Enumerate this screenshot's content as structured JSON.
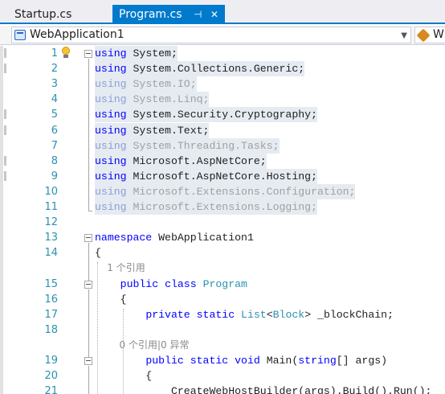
{
  "tabs": [
    {
      "label": "Startup.cs",
      "active": false
    },
    {
      "label": "Program.cs",
      "active": true,
      "pin_glyph": "⊣",
      "close_glyph": "✕"
    }
  ],
  "navbar": {
    "project": "WebApplication1",
    "member_partial": "W",
    "project_icon": "csharp-project-icon",
    "member_icon": "member-icon"
  },
  "editor": {
    "colors": {
      "keyword": "#0000ff",
      "type": "#2b91af",
      "line_number": "#2b91af",
      "selection": "#e5ebf1",
      "accent": "#007acc"
    },
    "lines": [
      {
        "n": "1",
        "tokens": [
          {
            "t": "using",
            "c": "kw"
          },
          {
            "t": " System;",
            "c": ""
          }
        ],
        "highlight": true,
        "faded": false,
        "fold": true,
        "bulb": true
      },
      {
        "n": "2",
        "tokens": [
          {
            "t": "using",
            "c": "kw"
          },
          {
            "t": " System.Collections.Generic;",
            "c": ""
          }
        ],
        "highlight": true,
        "faded": false
      },
      {
        "n": "3",
        "tokens": [
          {
            "t": "using",
            "c": "kw"
          },
          {
            "t": " System.IO;",
            "c": ""
          }
        ],
        "highlight": true,
        "faded": true
      },
      {
        "n": "4",
        "tokens": [
          {
            "t": "using",
            "c": "kw"
          },
          {
            "t": " System.Linq;",
            "c": ""
          }
        ],
        "highlight": true,
        "faded": true
      },
      {
        "n": "5",
        "tokens": [
          {
            "t": "using",
            "c": "kw"
          },
          {
            "t": " System.Security.Cryptography;",
            "c": ""
          }
        ],
        "highlight": true,
        "faded": false
      },
      {
        "n": "6",
        "tokens": [
          {
            "t": "using",
            "c": "kw"
          },
          {
            "t": " System.Text;",
            "c": ""
          }
        ],
        "highlight": true,
        "faded": false
      },
      {
        "n": "7",
        "tokens": [
          {
            "t": "using",
            "c": "kw"
          },
          {
            "t": " System.Threading.Tasks;",
            "c": ""
          }
        ],
        "highlight": true,
        "faded": true
      },
      {
        "n": "8",
        "tokens": [
          {
            "t": "using",
            "c": "kw"
          },
          {
            "t": " Microsoft.AspNetCore;",
            "c": ""
          }
        ],
        "highlight": true,
        "faded": false
      },
      {
        "n": "9",
        "tokens": [
          {
            "t": "using",
            "c": "kw"
          },
          {
            "t": " Microsoft.AspNetCore.Hosting;",
            "c": ""
          }
        ],
        "highlight": true,
        "faded": false
      },
      {
        "n": "10",
        "tokens": [
          {
            "t": "using",
            "c": "kw"
          },
          {
            "t": " Microsoft.Extensions.Configuration;",
            "c": ""
          }
        ],
        "highlight": true,
        "faded": true
      },
      {
        "n": "11",
        "tokens": [
          {
            "t": "using",
            "c": "kw"
          },
          {
            "t": " Microsoft.Extensions.Logging;",
            "c": ""
          }
        ],
        "highlight": true,
        "faded": true
      },
      {
        "n": "12",
        "tokens": []
      },
      {
        "n": "13",
        "tokens": [
          {
            "t": "namespace",
            "c": "kw"
          },
          {
            "t": " WebApplication1",
            "c": ""
          }
        ],
        "fold": true
      },
      {
        "n": "14",
        "tokens": [
          {
            "t": "{",
            "c": ""
          }
        ]
      },
      {
        "n": "",
        "codelens": "    1 个引用"
      },
      {
        "n": "15",
        "tokens": [
          {
            "t": "    ",
            "c": ""
          },
          {
            "t": "public",
            "c": "kw"
          },
          {
            "t": " ",
            "c": ""
          },
          {
            "t": "class",
            "c": "kw"
          },
          {
            "t": " ",
            "c": ""
          },
          {
            "t": "Program",
            "c": "typ"
          }
        ],
        "fold": true
      },
      {
        "n": "16",
        "tokens": [
          {
            "t": "    {",
            "c": ""
          }
        ]
      },
      {
        "n": "17",
        "tokens": [
          {
            "t": "        ",
            "c": ""
          },
          {
            "t": "private",
            "c": "kw"
          },
          {
            "t": " ",
            "c": ""
          },
          {
            "t": "static",
            "c": "kw"
          },
          {
            "t": " ",
            "c": ""
          },
          {
            "t": "List",
            "c": "typ"
          },
          {
            "t": "<",
            "c": ""
          },
          {
            "t": "Block",
            "c": "typ"
          },
          {
            "t": "> _blockChain;",
            "c": ""
          }
        ]
      },
      {
        "n": "18",
        "tokens": []
      },
      {
        "n": "",
        "codelens": "        0 个引用|0 异常"
      },
      {
        "n": "19",
        "tokens": [
          {
            "t": "        ",
            "c": ""
          },
          {
            "t": "public",
            "c": "kw"
          },
          {
            "t": " ",
            "c": ""
          },
          {
            "t": "static",
            "c": "kw"
          },
          {
            "t": " ",
            "c": ""
          },
          {
            "t": "void",
            "c": "kw"
          },
          {
            "t": " Main(",
            "c": ""
          },
          {
            "t": "string",
            "c": "kw"
          },
          {
            "t": "[] args)",
            "c": ""
          }
        ],
        "fold": true
      },
      {
        "n": "20",
        "tokens": [
          {
            "t": "        {",
            "c": ""
          }
        ]
      },
      {
        "n": "21",
        "tokens": [
          {
            "t": "            CreateWebHostBuilder(args).Build().Run();",
            "c": ""
          }
        ]
      }
    ]
  }
}
